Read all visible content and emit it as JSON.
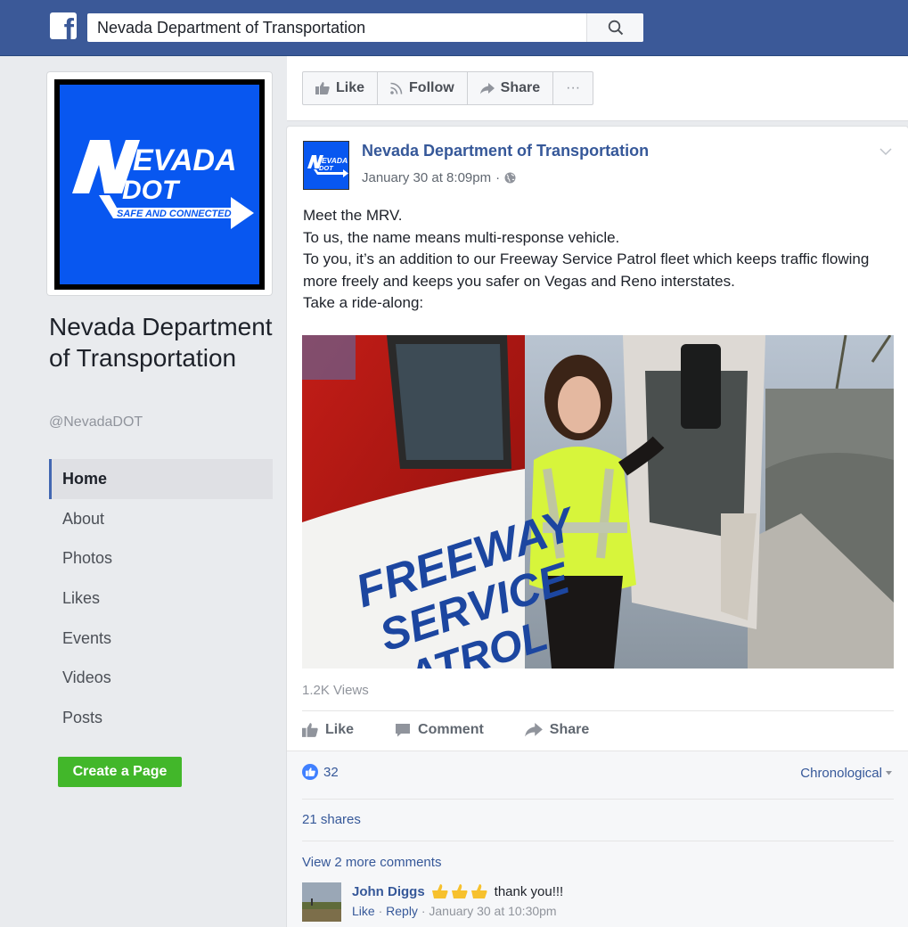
{
  "topbar": {
    "logo": "f",
    "search_value": "Nevada Department of Transportation",
    "search_icon": "search-icon"
  },
  "page": {
    "logo_text_top": "EVADA",
    "logo_text_dot": "DOT",
    "logo_tagline": "SAFE AND CONNECTED",
    "name": "Nevada Department of Transportation",
    "handle": "@NevadaDOT"
  },
  "nav": {
    "items": [
      {
        "label": "Home",
        "active": true
      },
      {
        "label": "About"
      },
      {
        "label": "Photos"
      },
      {
        "label": "Likes"
      },
      {
        "label": "Events"
      },
      {
        "label": "Videos"
      },
      {
        "label": "Posts"
      }
    ]
  },
  "create_page_label": "Create a Page",
  "actions": {
    "like": "Like",
    "follow": "Follow",
    "share": "Share",
    "more": "···"
  },
  "post": {
    "author": "Nevada Department of Transportation",
    "time": "January 30 at 8:09pm",
    "privacy_icon": "globe-icon",
    "lines": [
      "Meet the MRV.",
      "To us, the name means multi-response vehicle.",
      "To you, it’s an addition to our Freeway Service Patrol fleet which keeps traffic flowing more freely and keeps you safer on Vegas and Reno interstates.",
      "Take a ride-along:"
    ],
    "video_overlay_text": [
      "FREEWAY",
      "SERVICE",
      "ATROL"
    ],
    "views": "1.2K Views",
    "actions": {
      "like": "Like",
      "comment": "Comment",
      "share": "Share"
    },
    "likes_count": "32",
    "order": "Chronological",
    "shares": "21 shares",
    "more_comments": "View 2 more comments",
    "comment": {
      "author": "John Diggs",
      "text": "thank you!!!",
      "like": "Like",
      "reply": "Reply",
      "time": "January 30 at 10:30pm"
    }
  },
  "colors": {
    "brand": "#3b5998",
    "link": "#365899",
    "page_blue": "#0857f0",
    "green": "#42b72a"
  }
}
